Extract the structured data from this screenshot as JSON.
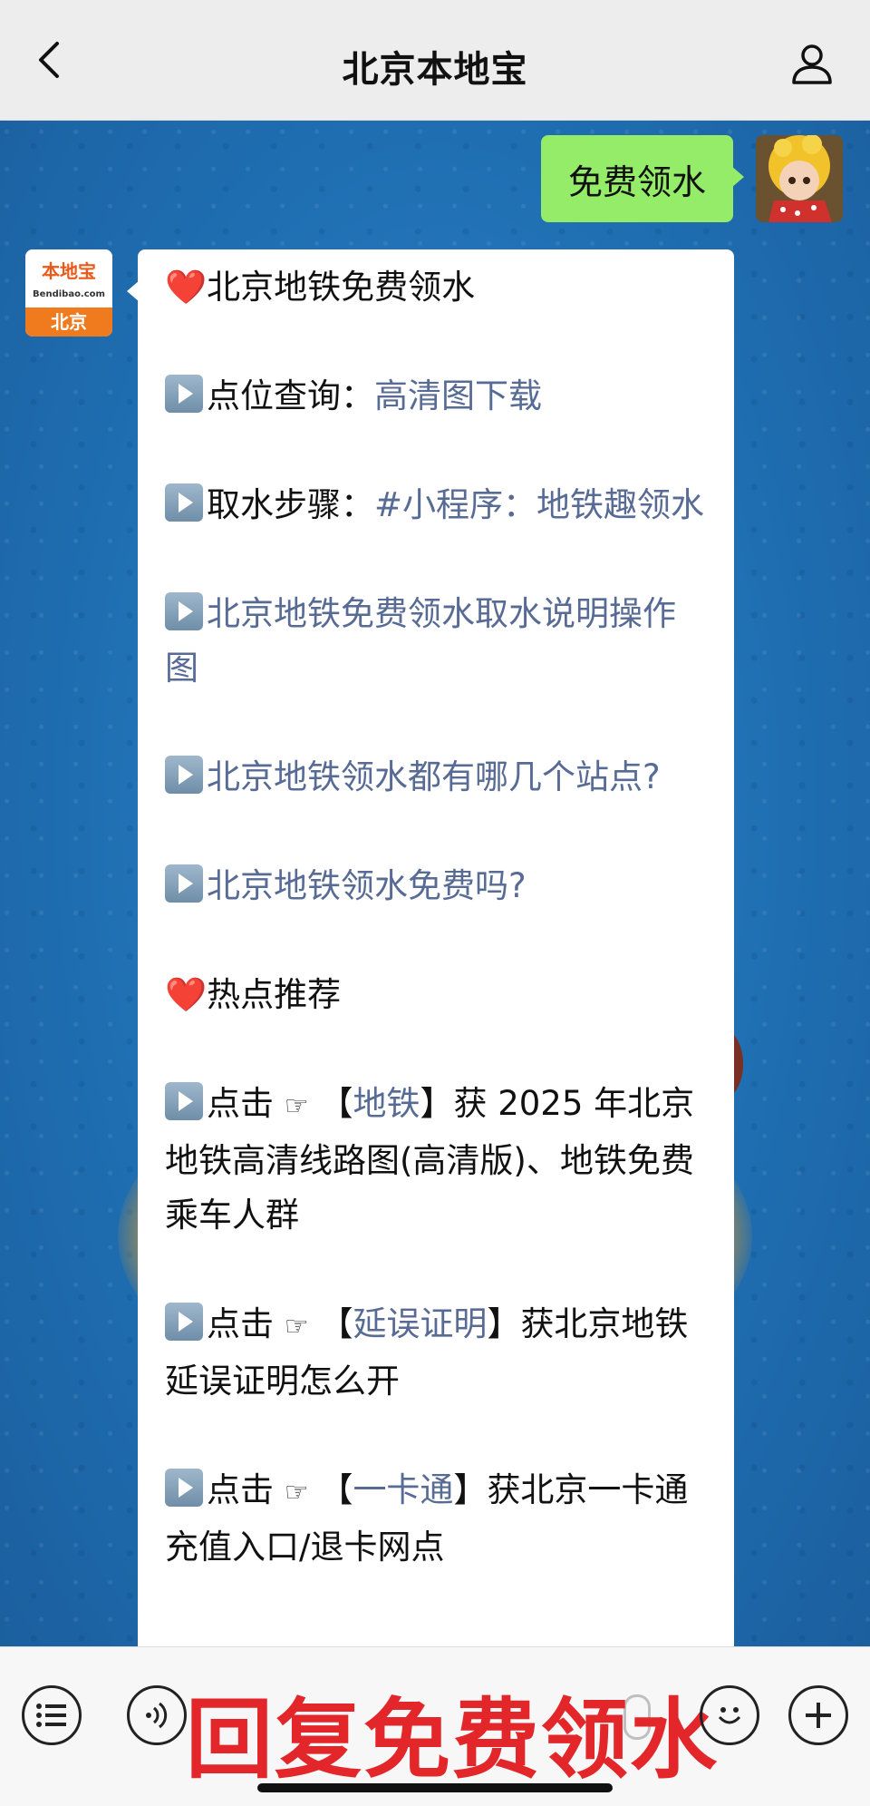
{
  "header": {
    "title": "北京本地宝"
  },
  "outgoing": {
    "text": "免费领水"
  },
  "bot": {
    "brand": "本地宝",
    "sub": "Bendibao.com",
    "city": "北京"
  },
  "message": {
    "heading": "北京地铁免费领水",
    "point_label": "点位查询：",
    "point_link": "高清图下载",
    "step_label": "取水步骤：",
    "step_link": "#小程序：地铁趣领水",
    "item1": "北京地铁免费领水取水说明操作图",
    "item2": "北京地铁领水都有哪几个站点?",
    "item3": "北京地铁领水免费吗?",
    "hot_heading": "热点推荐",
    "hot1_prefix": "点击",
    "hot1_link": "地铁",
    "hot1_text": "获 2025 年北京地铁高清线路图(高清版)、地铁免费乘车人群",
    "hot2_prefix": "点击",
    "hot2_link": "延误证明",
    "hot2_text": "获北京地铁延误证明怎么开",
    "hot3_prefix": "点击",
    "hot3_link": "一卡通",
    "hot3_text": "获北京一卡通充值入口/退卡网点",
    "hand_icon": "☞",
    "bracket_open": "【",
    "bracket_close": "】"
  },
  "overlay": {
    "text": "回复免费领水"
  },
  "colors": {
    "link": "#576b95",
    "outgoing_bubble": "#95ec69",
    "overlay_text": "#e3262a",
    "chat_background": "#1f6fb3"
  },
  "icons": {
    "back": "chevron-left-icon",
    "profile": "person-icon",
    "menu": "list-icon",
    "voice": "voice-icon",
    "emoji": "emoji-icon",
    "plus": "plus-icon"
  }
}
